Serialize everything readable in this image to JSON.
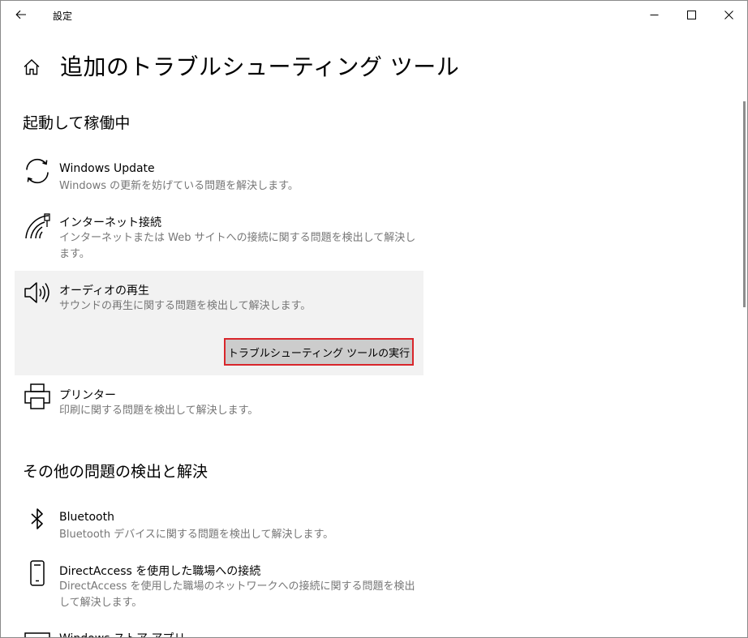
{
  "window": {
    "title": "設定",
    "controls": {
      "minimize_icon": "minimize-icon",
      "maximize_icon": "maximize-icon",
      "close_icon": "close-icon"
    }
  },
  "page": {
    "title": "追加のトラブルシューティング ツール"
  },
  "sections": {
    "running": {
      "heading": "起動して稼働中",
      "items": [
        {
          "icon": "sync-icon",
          "title": "Windows Update",
          "desc": "Windows の更新を妨げている問題を解決します。"
        },
        {
          "icon": "wifi-icon",
          "title": "インターネット接続",
          "desc": "インターネットまたは Web サイトへの接続に関する問題を検出して解決します。"
        },
        {
          "icon": "speaker-icon",
          "title": "オーディオの再生",
          "desc": "サウンドの再生に関する問題を検出して解決します。",
          "button": "トラブルシューティング ツールの実行"
        },
        {
          "icon": "printer-icon",
          "title": "プリンター",
          "desc": "印刷に関する問題を検出して解決します。"
        }
      ]
    },
    "other": {
      "heading": "その他の問題の検出と解決",
      "items": [
        {
          "icon": "bluetooth-icon",
          "title": "Bluetooth",
          "desc": "Bluetooth デバイスに関する問題を検出して解決します。"
        },
        {
          "icon": "phone-icon",
          "title": "DirectAccess を使用した職場への接続",
          "desc": "DirectAccess を使用した職場のネットワークへの接続に関する問題を検出して解決します。"
        },
        {
          "icon": "store-icon",
          "title": "Windows ストア アプリ",
          "desc": ""
        }
      ]
    }
  }
}
